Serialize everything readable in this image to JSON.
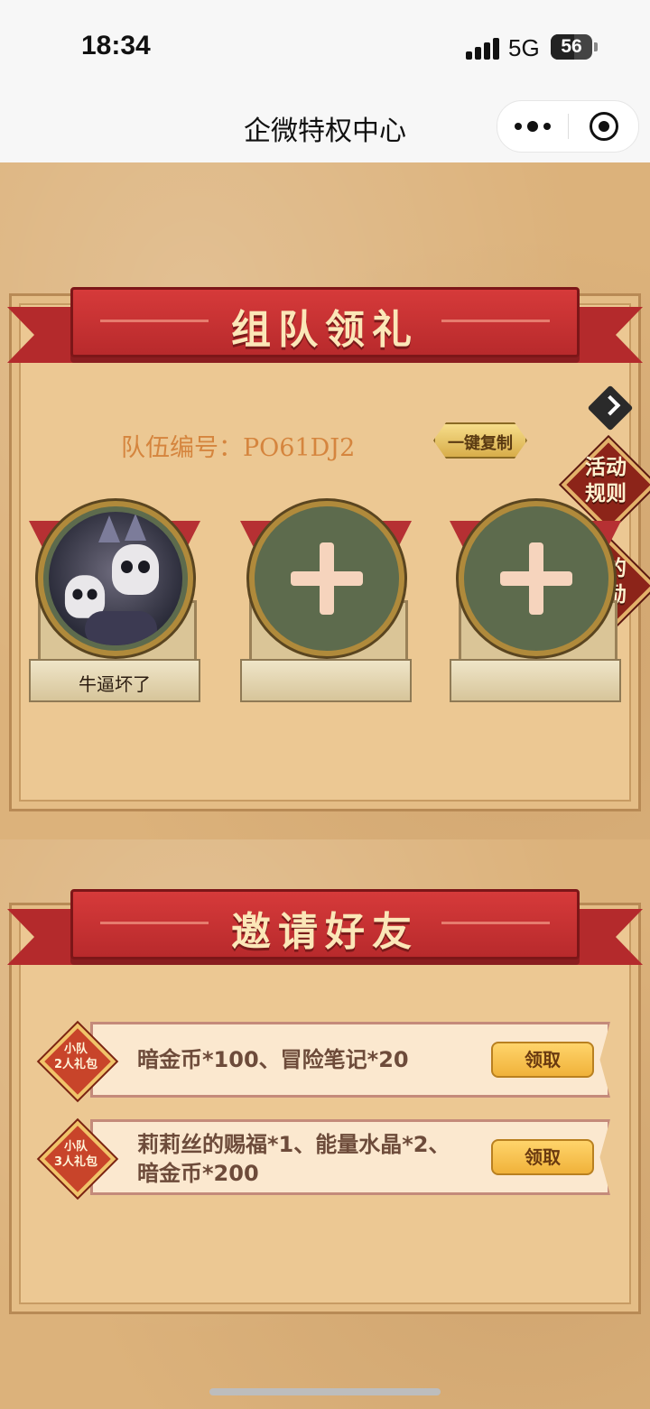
{
  "status_bar": {
    "time": "18:34",
    "network": "5G",
    "battery": "56"
  },
  "nav": {
    "title": "企微特权中心"
  },
  "team_section": {
    "title": "组队领礼",
    "team_id_label": "队伍编号：PO61DJ2",
    "copy_button": "一键复制",
    "side_buttons": {
      "rules": "活动\n规则",
      "rewards": "我的\n奖励"
    },
    "members": [
      {
        "name": "牛逼坏了",
        "filled": true
      },
      {
        "name": "",
        "filled": false
      },
      {
        "name": "",
        "filled": false
      }
    ]
  },
  "invite_section": {
    "title": "邀请好友",
    "rewards": [
      {
        "badge_top": "小队",
        "badge_bottom": "2人礼包",
        "text": "暗金币*100、冒险笔记*20",
        "button": "领取"
      },
      {
        "badge_top": "小队",
        "badge_bottom": "3人礼包",
        "text": "莉莉丝的赐福*1、能量水晶*2、暗金币*200",
        "button": "领取"
      }
    ]
  },
  "colors": {
    "ribbon": "#b42a2c",
    "accent_gold": "#f0b23a",
    "team_id": "#d5853e"
  },
  "icons": {
    "more": "more-dots-icon",
    "close": "target-circle-icon",
    "arrow": "chevron-right-icon",
    "plus": "plus-icon"
  }
}
